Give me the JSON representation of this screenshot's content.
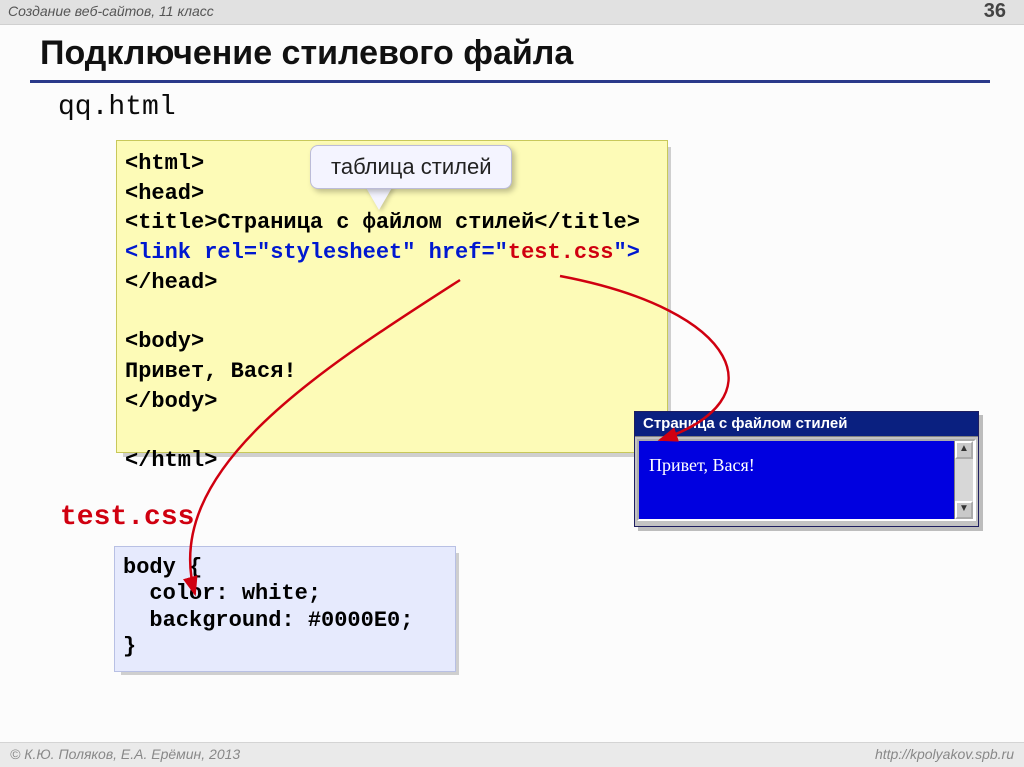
{
  "header": {
    "course": "Создание веб-сайтов, 11 класс",
    "page_number": "36"
  },
  "title": "Подключение стилевого файла",
  "html_file": {
    "filename": "qq.html",
    "lines": {
      "l1": "<html>",
      "l2": "<head>",
      "l3a": "<title>",
      "l3b": "Страница с файлом стилей",
      "l3c": "</title>",
      "l4a": "<link rel=\"stylesheet\" href=\"",
      "l4b": "test.css",
      "l4c": "\">",
      "l5": "</head>",
      "l6": "<body>",
      "l7": "Привет, Вася!",
      "l8": "</body>",
      "l9": "</html>"
    }
  },
  "callout": "таблица стилей",
  "css_file": {
    "filename": "test.css",
    "lines": {
      "l1": "body {",
      "l2": "  color: white;",
      "l3": "  background: #0000E0;",
      "l4": "}"
    }
  },
  "browser": {
    "title": "Страница с файлом стилей",
    "body": "Привет, Вася!",
    "scroll_up": "▲",
    "scroll_down": "▼"
  },
  "footer": {
    "left": "© К.Ю. Поляков, Е.А. Ерёмин, 2013",
    "right": "http://kpolyakov.spb.ru"
  }
}
